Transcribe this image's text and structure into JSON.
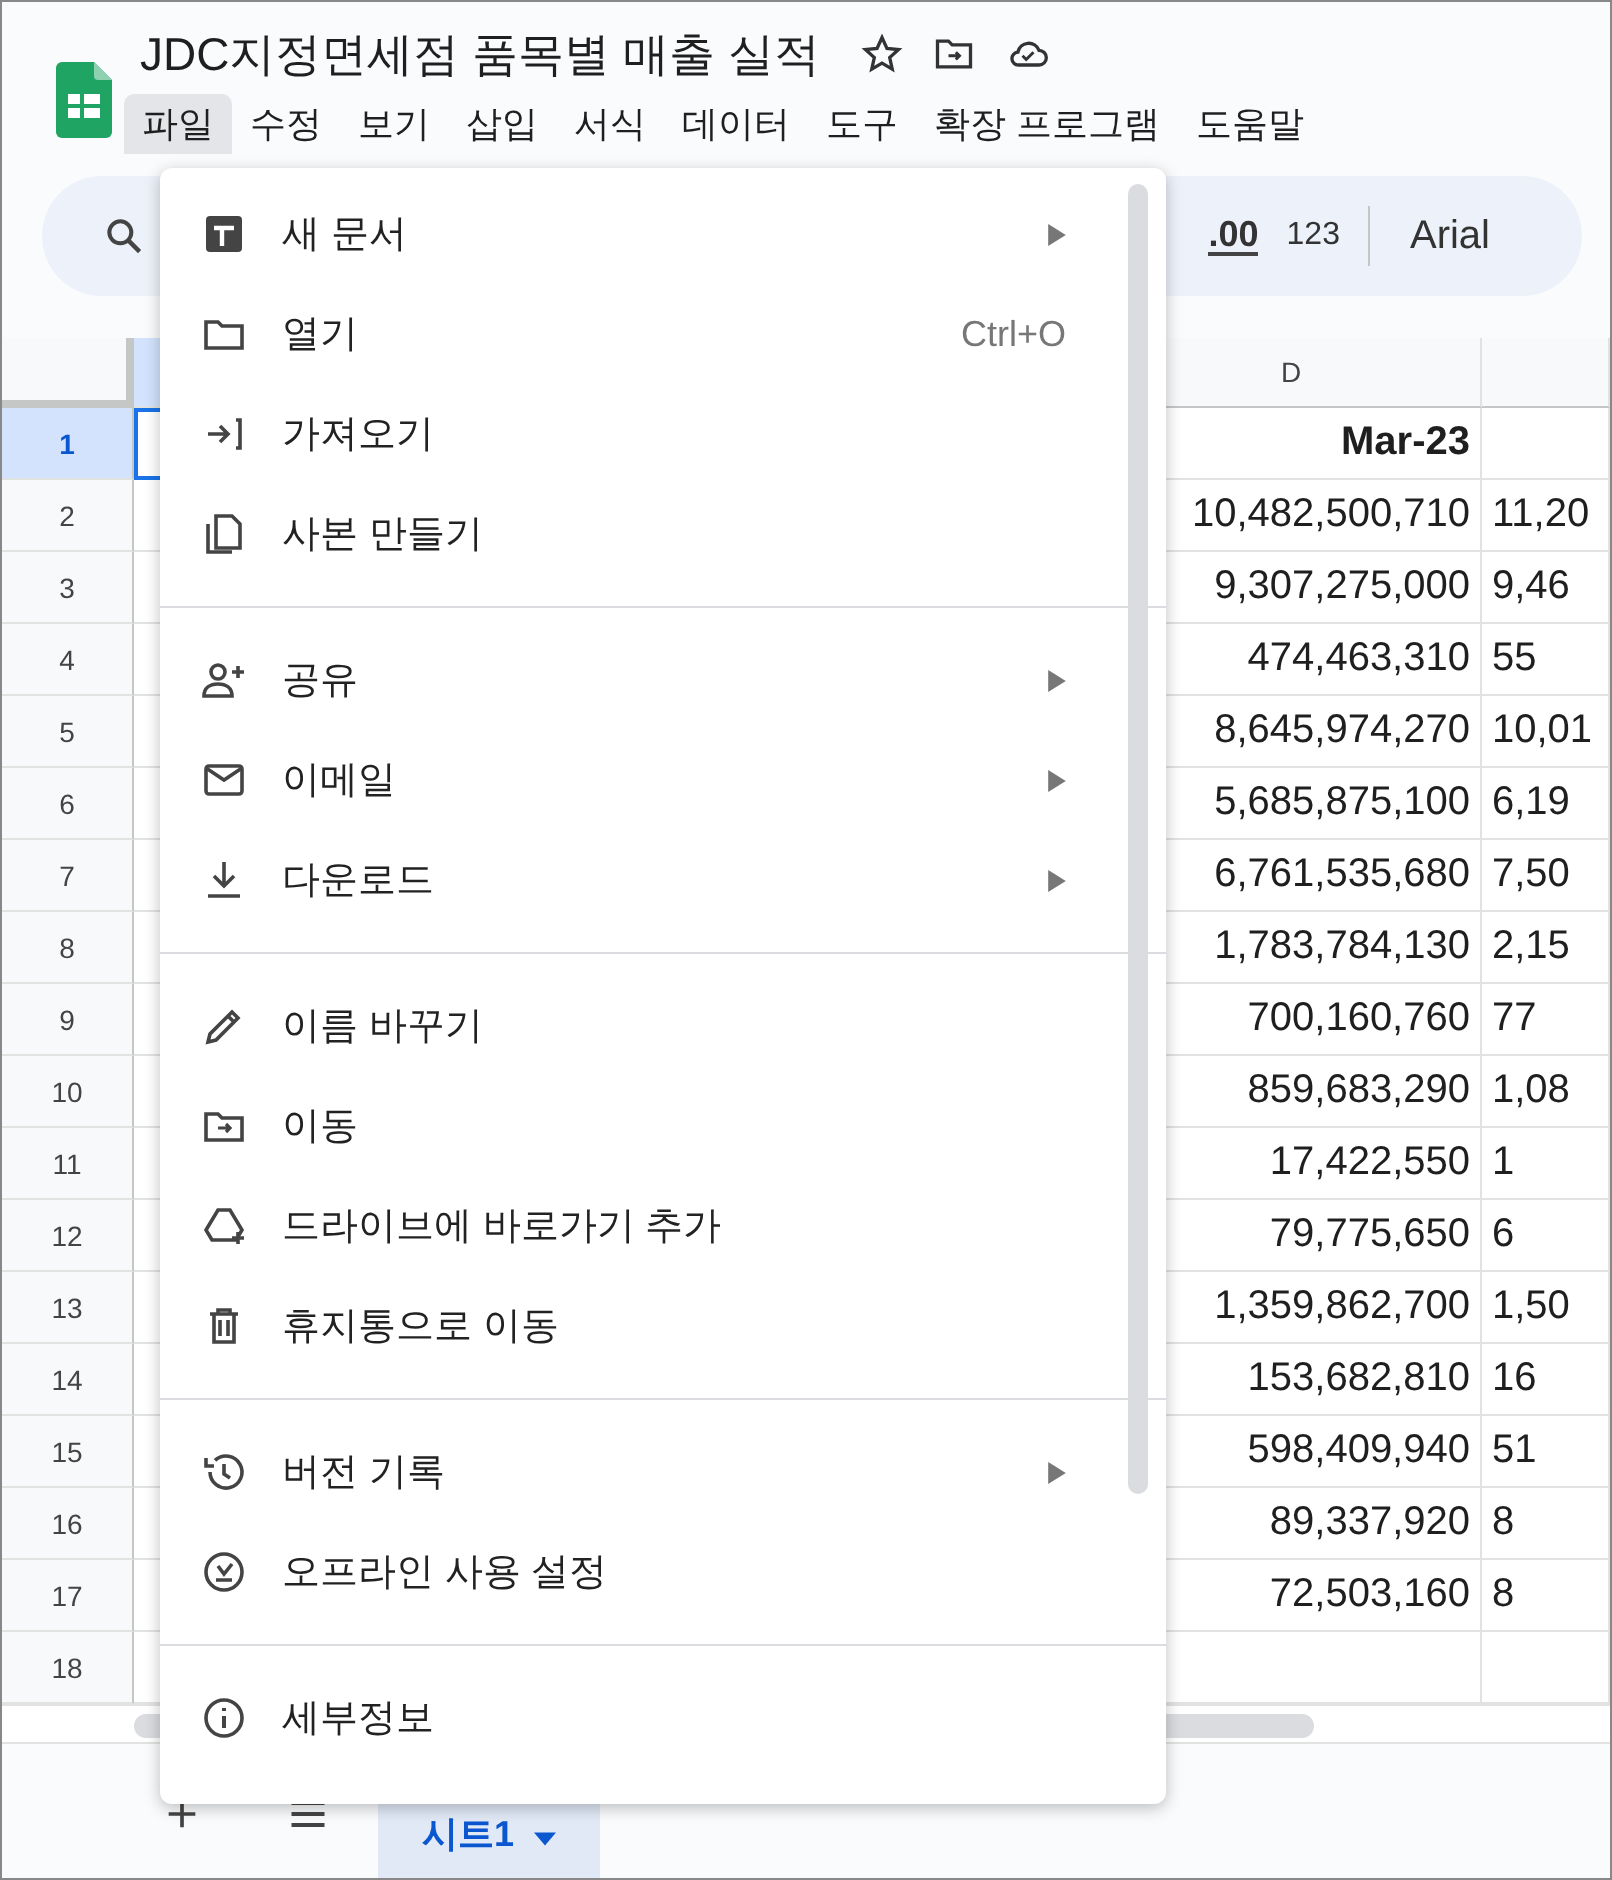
{
  "document": {
    "title": "JDC지정면세점 품목별 매출 실적"
  },
  "menu_bar": [
    {
      "label": "파일",
      "selected": true
    },
    {
      "label": "수정",
      "selected": false
    },
    {
      "label": "보기",
      "selected": false
    },
    {
      "label": "삽입",
      "selected": false
    },
    {
      "label": "서식",
      "selected": false
    },
    {
      "label": "데이터",
      "selected": false
    },
    {
      "label": "도구",
      "selected": false
    },
    {
      "label": "확장 프로그램",
      "selected": false
    },
    {
      "label": "도움말",
      "selected": false
    }
  ],
  "toolbar": {
    "decimal": ".00",
    "number_format": "123",
    "font": "Arial"
  },
  "table": {
    "column_d": "D",
    "rows": [
      {
        "number": "1",
        "selected": true,
        "bold": true,
        "d": "Mar-23",
        "e": ""
      },
      {
        "number": "2",
        "selected": false,
        "bold": false,
        "d": "10,482,500,710",
        "e": "11,20"
      },
      {
        "number": "3",
        "selected": false,
        "bold": false,
        "d": "9,307,275,000",
        "e": "9,46"
      },
      {
        "number": "4",
        "selected": false,
        "bold": false,
        "d": "474,463,310",
        "e": "55"
      },
      {
        "number": "5",
        "selected": false,
        "bold": false,
        "d": "8,645,974,270",
        "e": "10,01"
      },
      {
        "number": "6",
        "selected": false,
        "bold": false,
        "d": "5,685,875,100",
        "e": "6,19"
      },
      {
        "number": "7",
        "selected": false,
        "bold": false,
        "d": "6,761,535,680",
        "e": "7,50"
      },
      {
        "number": "8",
        "selected": false,
        "bold": false,
        "d": "1,783,784,130",
        "e": "2,15"
      },
      {
        "number": "9",
        "selected": false,
        "bold": false,
        "d": "700,160,760",
        "e": "77"
      },
      {
        "number": "10",
        "selected": false,
        "bold": false,
        "d": "859,683,290",
        "e": "1,08"
      },
      {
        "number": "11",
        "selected": false,
        "bold": false,
        "d": "17,422,550",
        "e": "1"
      },
      {
        "number": "12",
        "selected": false,
        "bold": false,
        "d": "79,775,650",
        "e": "6"
      },
      {
        "number": "13",
        "selected": false,
        "bold": false,
        "d": "1,359,862,700",
        "e": "1,50"
      },
      {
        "number": "14",
        "selected": false,
        "bold": false,
        "d": "153,682,810",
        "e": "16"
      },
      {
        "number": "15",
        "selected": false,
        "bold": false,
        "d": "598,409,940",
        "e": "51"
      },
      {
        "number": "16",
        "selected": false,
        "bold": false,
        "d": "89,337,920",
        "e": "8"
      },
      {
        "number": "17",
        "selected": false,
        "bold": false,
        "d": "72,503,160",
        "e": "8"
      },
      {
        "number": "18",
        "selected": false,
        "d": "",
        "e": ""
      }
    ]
  },
  "file_menu": {
    "groups": [
      {
        "items": [
          {
            "label": "새 문서",
            "submenu": true
          },
          {
            "label": "열기",
            "shortcut": "Ctrl+O",
            "submenu": false
          },
          {
            "label": "가져오기",
            "submenu": false
          },
          {
            "label": "사본 만들기",
            "submenu": false
          }
        ]
      },
      {
        "items": [
          {
            "label": "공유",
            "submenu": true
          },
          {
            "label": "이메일",
            "submenu": true
          },
          {
            "label": "다운로드",
            "submenu": true
          }
        ]
      },
      {
        "items": [
          {
            "label": "이름 바꾸기",
            "submenu": false
          },
          {
            "label": "이동",
            "submenu": false
          },
          {
            "label": "드라이브에 바로가기 추가",
            "submenu": false
          },
          {
            "label": "휴지통으로 이동",
            "submenu": false
          }
        ]
      },
      {
        "items": [
          {
            "label": "버전 기록",
            "submenu": true
          },
          {
            "label": "오프라인 사용 설정",
            "submenu": false
          }
        ]
      },
      {
        "items": [
          {
            "label": "세부정보",
            "submenu": false
          }
        ]
      }
    ]
  },
  "sheet_tabs": [
    {
      "label": "시트1",
      "selected": true
    }
  ]
}
